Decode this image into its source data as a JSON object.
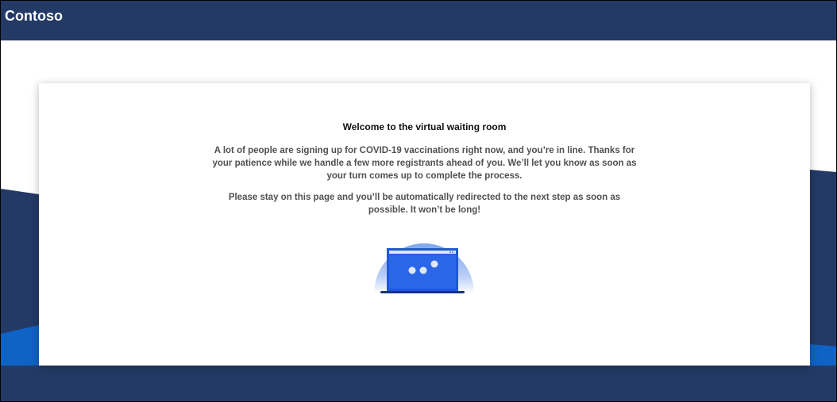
{
  "header": {
    "brand": "Contoso"
  },
  "card": {
    "title": "Welcome to the virtual waiting room",
    "paragraph1": "A lot of people are signing up for COVID-19 vaccinations right now, and you’re in line. Thanks for your patience while we handle a few more registrants ahead of you. We’ll let you know as soon as your turn comes up to complete the process.",
    "paragraph2": "Please stay on this page and you’ll be automatically redirected to the next step as soon as possible. It won’t be long!",
    "illustration_icon": "laptop-loading-icon"
  },
  "colors": {
    "header_bg": "#243a66",
    "page_navy": "#243a66",
    "accent_blue": "#0f63c6",
    "laptop_blue": "#1f58d6"
  }
}
